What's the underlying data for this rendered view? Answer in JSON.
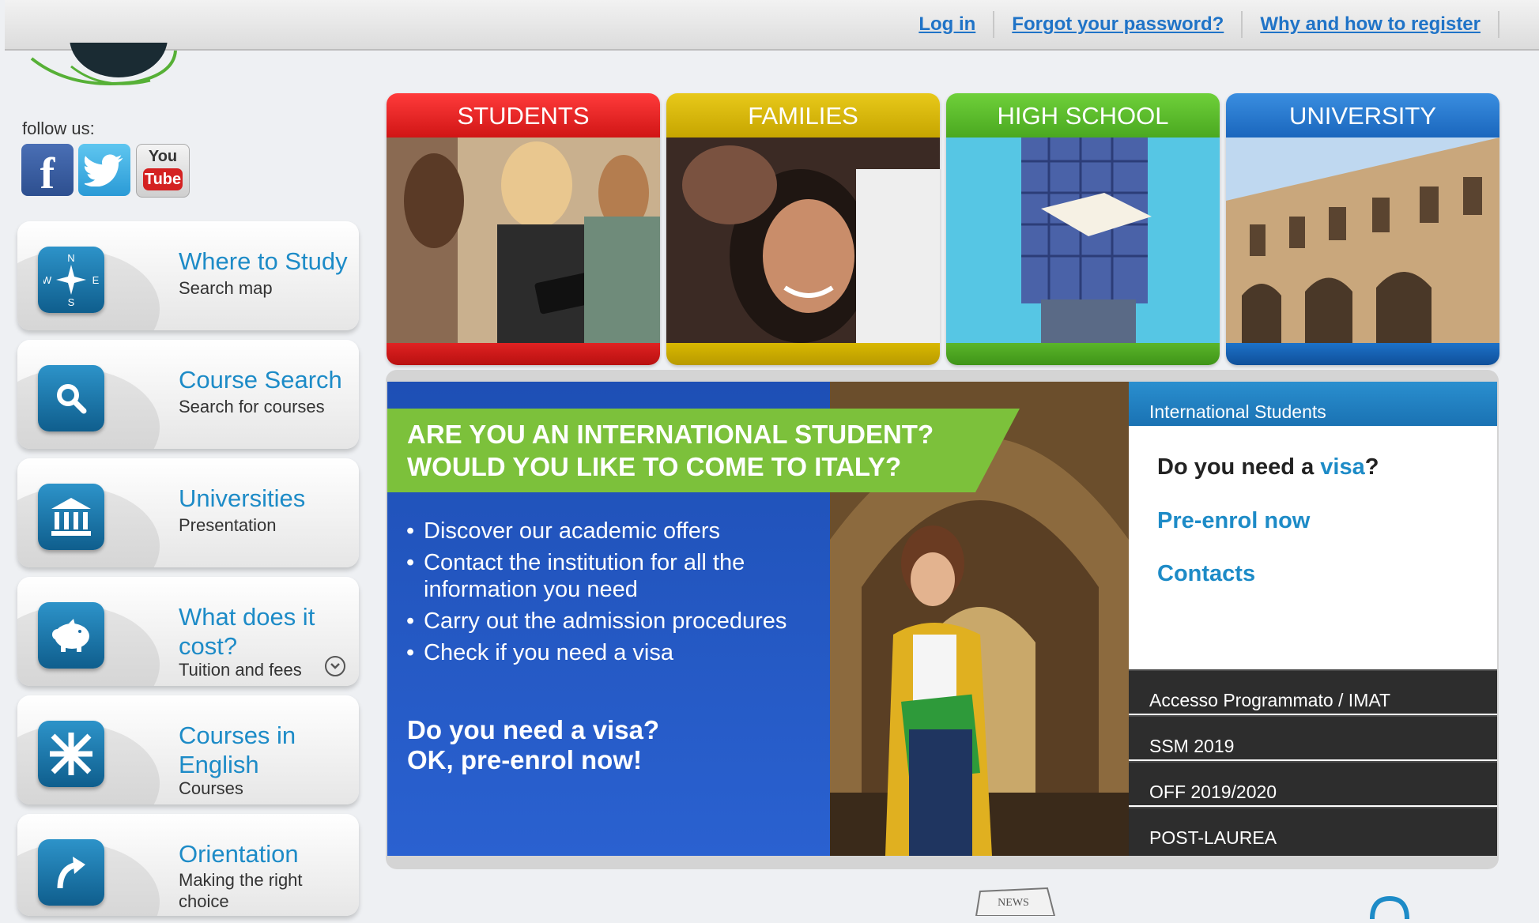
{
  "topbar": {
    "links": [
      {
        "label": "Log in"
      },
      {
        "label": "Forgot your password?"
      },
      {
        "label": "Why and how to register"
      }
    ]
  },
  "follow": {
    "label": "follow us:",
    "social": [
      "facebook-icon",
      "twitter-icon",
      "youtube-icon"
    ],
    "youtube_text": [
      "You",
      "Tube"
    ]
  },
  "sidebar": {
    "items": [
      {
        "title": "Where to Study",
        "subtitle": "Search map",
        "icon": "compass-icon"
      },
      {
        "title": "Course Search",
        "subtitle": "Search for courses",
        "icon": "search-icon"
      },
      {
        "title": "Universities",
        "subtitle": "Presentation",
        "icon": "university-building-icon"
      },
      {
        "title": "What does it cost?",
        "subtitle": "Tuition and fees",
        "icon": "piggy-bank-icon"
      },
      {
        "title": "Courses in English",
        "subtitle": "Courses",
        "icon": "uk-flag-icon"
      },
      {
        "title": "Orientation",
        "subtitle": "Making the right choice",
        "icon": "arrow-turn-icon"
      }
    ]
  },
  "categories": [
    {
      "label": "STUDENTS",
      "color": "#e02222"
    },
    {
      "label": "FAMILIES",
      "color": "#d9b800"
    },
    {
      "label": "HIGH SCHOOL",
      "color": "#5ab52a"
    },
    {
      "label": "UNIVERSITY",
      "color": "#1d72c9"
    }
  ],
  "banner": {
    "headline_1": "ARE YOU AN INTERNATIONAL STUDENT?",
    "headline_2": "WOULD YOU LIKE TO COME TO ITALY?",
    "bullets": [
      "Discover our academic offers",
      "Contact the institution for all the information you need",
      "Carry out the admission procedures",
      "Check if you need a visa"
    ],
    "cta_1": "Do you need a visa?",
    "cta_2": "OK, pre-enrol now!"
  },
  "intl": {
    "header": "International Students",
    "visa_prefix": "Do you need a ",
    "visa_word": "visa",
    "visa_suffix": "?",
    "preenrol": "Pre-enrol now",
    "contacts": "Contacts",
    "dark_items": [
      "Accesso Programmato / IMAT",
      "SSM 2019",
      "OFF 2019/2020",
      "POST-LAUREA"
    ]
  },
  "bottom": {
    "news_label": "NEWS"
  }
}
